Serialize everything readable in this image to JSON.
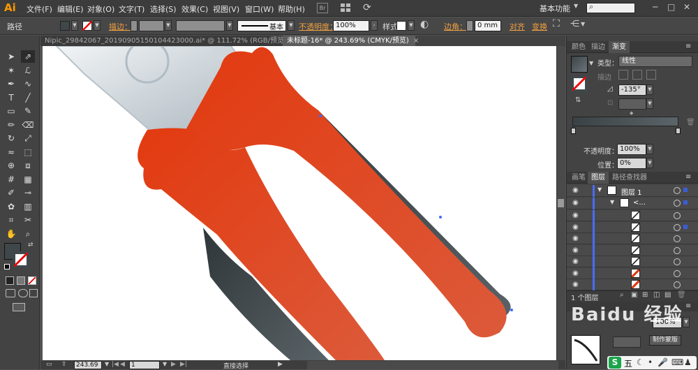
{
  "app": {
    "logo": "Ai"
  },
  "menu": [
    "文件(F)",
    "编辑(E)",
    "对象(O)",
    "文字(T)",
    "选择(S)",
    "效果(C)",
    "视图(V)",
    "窗口(W)",
    "帮助(H)"
  ],
  "menubar": {
    "br_label": "Br",
    "workspace": "基本功能"
  },
  "control": {
    "selection_label": "路径",
    "stroke_label": "描边：",
    "stroke_style_label": "基本",
    "opacity_label": "不透明度：",
    "opacity_value": "100%",
    "style_label": "样式：",
    "corner_label": "边角：",
    "corner_value": "0 mm",
    "align_label": "对齐",
    "transform_label": "变换"
  },
  "tabs": [
    {
      "title": "Nipic_29842067_20190905150104423000.ai* @ 111.72% (RGB/预览)",
      "close": "×"
    },
    {
      "title": "未标题-16* @ 243.69% (CMYK/预览)",
      "close": "×"
    }
  ],
  "tools": [
    "select-tool",
    "direct-select-tool",
    "magic-wand-tool",
    "lasso-tool",
    "pen-tool",
    "curvature-tool",
    "type-tool",
    "line-tool",
    "rectangle-tool",
    "paintbrush-tool",
    "pencil-tool",
    "eraser-tool",
    "rotate-tool",
    "scale-tool",
    "warp-tool",
    "free-transform-tool",
    "shape-builder-tool",
    "perspective-tool",
    "mesh-tool",
    "gradient-tool",
    "eyedropper-tool",
    "blend-tool",
    "symbol-sprayer-tool",
    "graph-tool",
    "artboard-tool",
    "slice-tool",
    "hand-tool",
    "zoom-tool"
  ],
  "status": {
    "zoom": "243.69",
    "page": "1",
    "tool_name": "直接选择"
  },
  "gradient_panel": {
    "tabs": [
      "颜色",
      "描边",
      "渐变"
    ],
    "type_label": "类型：",
    "type_value": "线性",
    "stroke_label": "描边",
    "angle_value": "-135°",
    "opacity_label": "不透明度：",
    "opacity_value": "100%",
    "position_label": "位置：",
    "position_value": "0%",
    "colors": {
      "start": "#3a4245",
      "end": "#5b6468"
    }
  },
  "layers_panel": {
    "tabs": [
      "画笔",
      "图层",
      "路径查找器"
    ],
    "layer_name": "图层 1",
    "group_name": "<...",
    "footer_count": "1 个图层",
    "sublayer_count": 7
  },
  "bottom_panel": {
    "label": "制作蒙版",
    "opacity_value": "100%"
  },
  "watermark": "Baidu 经验",
  "colors": {
    "handle_red": "#e03a12",
    "grip_dark": "#3c4447",
    "metal": "#c9d2d8",
    "brand_orange": "#ff9a00"
  }
}
